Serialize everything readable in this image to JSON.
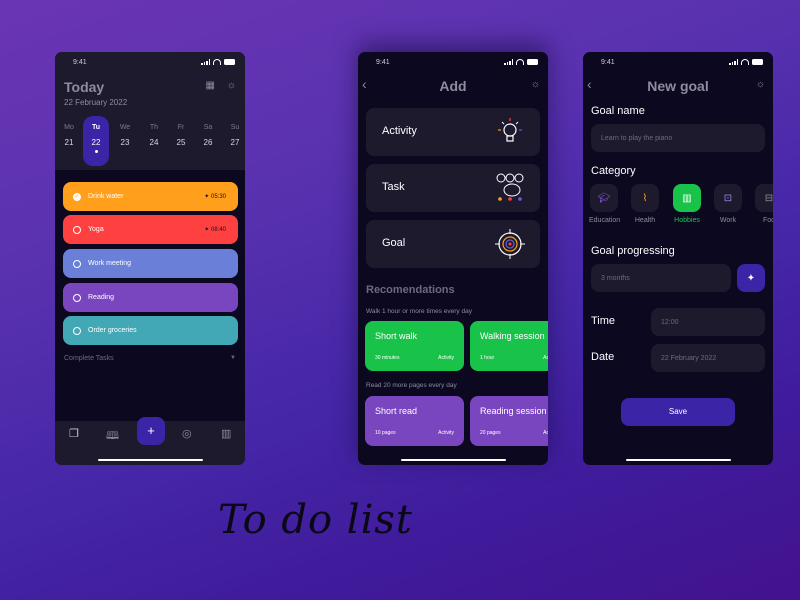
{
  "caption": "To do list",
  "colors": {
    "accent": "#3b25a6",
    "green": "#19c34a",
    "orange": "#ff9f1c",
    "red": "#ff4040",
    "blue": "#6a80d8",
    "purple": "#7a46c0",
    "teal": "#42a8b6",
    "card": "#1d1a2e"
  },
  "status_time": "9:41",
  "today": {
    "title": "Today",
    "date": "22 February 2022",
    "icons": [
      "calendar-icon",
      "sun-icon"
    ],
    "week": [
      {
        "day": "Mo",
        "date": "21",
        "selected": false
      },
      {
        "day": "Tu",
        "date": "22",
        "selected": true
      },
      {
        "day": "We",
        "date": "23",
        "selected": false
      },
      {
        "day": "Th",
        "date": "24",
        "selected": false
      },
      {
        "day": "Fr",
        "date": "25",
        "selected": false
      },
      {
        "day": "Sa",
        "date": "26",
        "selected": false
      },
      {
        "day": "Su",
        "date": "27",
        "selected": false
      }
    ],
    "tasks": [
      {
        "label": "Drink water",
        "time": "05:30",
        "done": true,
        "color": "#ff9f1c"
      },
      {
        "label": "Yoga",
        "time": "08:40",
        "done": false,
        "color": "#ff4040"
      },
      {
        "label": "Work meeting",
        "time": "",
        "done": false,
        "color": "#6a80d8"
      },
      {
        "label": "Reading",
        "time": "",
        "done": false,
        "color": "#7a46c0"
      },
      {
        "label": "Order groceries",
        "time": "",
        "done": false,
        "color": "#42a8b6"
      }
    ],
    "complete_label": "Complete Tasks",
    "tabbar": [
      "documents-icon",
      "book-icon",
      "plus-icon",
      "target-icon",
      "stats-icon"
    ]
  },
  "add": {
    "title": "Add",
    "cards": [
      {
        "label": "Activity",
        "icon": "lightbulb-icon"
      },
      {
        "label": "Task",
        "icon": "numbered-steps-icon"
      },
      {
        "label": "Goal",
        "icon": "crosshair-target-icon"
      }
    ],
    "recommendations_title": "Recomendations",
    "groups": [
      {
        "subtitle": "Walk 1 hour or more times every day",
        "color": "#19c34a",
        "items": [
          {
            "title": "Short walk",
            "meta": "30 minutes",
            "kind": "Activity"
          },
          {
            "title": "Walking session",
            "meta": "1 hour",
            "kind": "Activity"
          }
        ]
      },
      {
        "subtitle": "Read 20 more pages every day",
        "color": "#7a46c0",
        "items": [
          {
            "title": "Short read",
            "meta": "10 pages",
            "kind": "Activity"
          },
          {
            "title": "Reading session",
            "meta": "20 pages",
            "kind": "Activity"
          }
        ]
      }
    ]
  },
  "new_goal": {
    "title": "New goal",
    "goal_name_label": "Goal name",
    "goal_name_placeholder": "Learn to play the piano",
    "category_label": "Category",
    "categories": [
      {
        "label": "Education",
        "icon": "graduation-cap-icon",
        "selected": false
      },
      {
        "label": "Health",
        "icon": "heartbeat-icon",
        "selected": false
      },
      {
        "label": "Hobbies",
        "icon": "piano-icon",
        "selected": true
      },
      {
        "label": "Work",
        "icon": "briefcase-icon",
        "selected": false
      },
      {
        "label": "Foo",
        "icon": "folder-icon",
        "selected": false
      }
    ],
    "progress_label": "Goal progressing",
    "progress_value": "3 months",
    "time_label": "Time",
    "time_value": "12:00",
    "date_label": "Date",
    "date_value": "22 February 2022",
    "save_label": "Save"
  }
}
